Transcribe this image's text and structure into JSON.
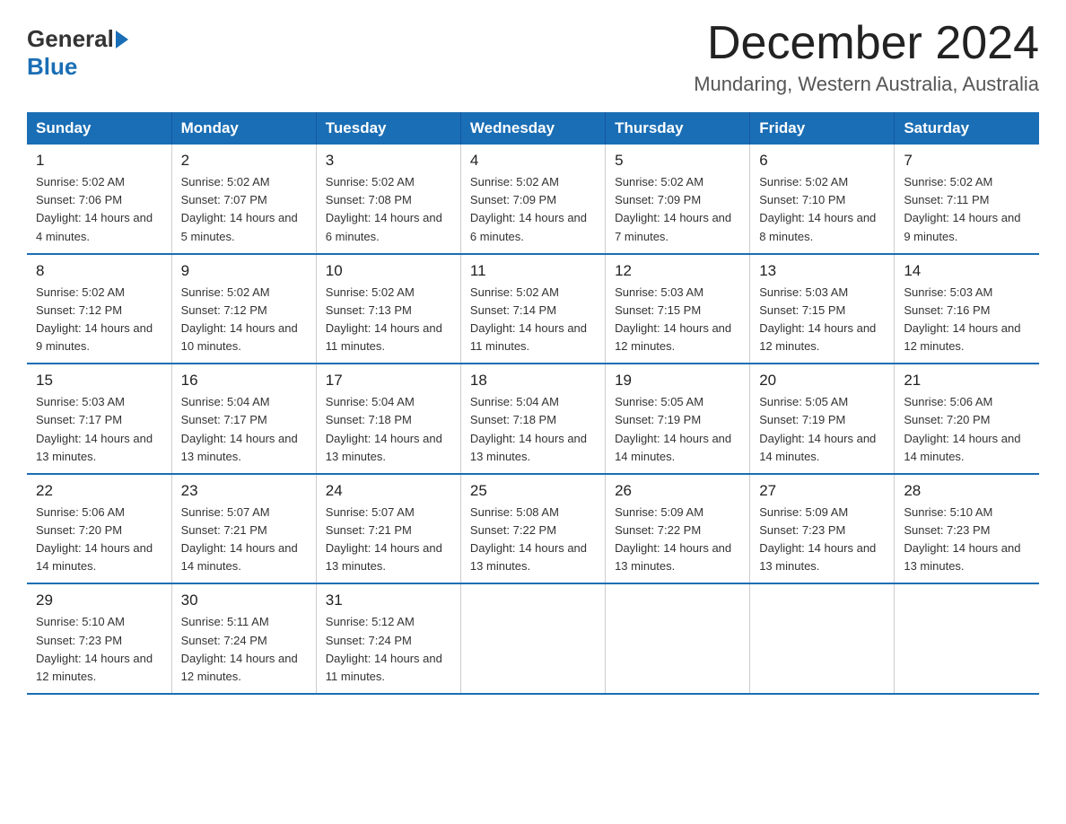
{
  "logo": {
    "general": "General",
    "blue": "Blue"
  },
  "title": "December 2024",
  "location": "Mundaring, Western Australia, Australia",
  "days_of_week": [
    "Sunday",
    "Monday",
    "Tuesday",
    "Wednesday",
    "Thursday",
    "Friday",
    "Saturday"
  ],
  "weeks": [
    [
      {
        "day": "1",
        "sunrise": "5:02 AM",
        "sunset": "7:06 PM",
        "daylight": "14 hours and 4 minutes."
      },
      {
        "day": "2",
        "sunrise": "5:02 AM",
        "sunset": "7:07 PM",
        "daylight": "14 hours and 5 minutes."
      },
      {
        "day": "3",
        "sunrise": "5:02 AM",
        "sunset": "7:08 PM",
        "daylight": "14 hours and 6 minutes."
      },
      {
        "day": "4",
        "sunrise": "5:02 AM",
        "sunset": "7:09 PM",
        "daylight": "14 hours and 6 minutes."
      },
      {
        "day": "5",
        "sunrise": "5:02 AM",
        "sunset": "7:09 PM",
        "daylight": "14 hours and 7 minutes."
      },
      {
        "day": "6",
        "sunrise": "5:02 AM",
        "sunset": "7:10 PM",
        "daylight": "14 hours and 8 minutes."
      },
      {
        "day": "7",
        "sunrise": "5:02 AM",
        "sunset": "7:11 PM",
        "daylight": "14 hours and 9 minutes."
      }
    ],
    [
      {
        "day": "8",
        "sunrise": "5:02 AM",
        "sunset": "7:12 PM",
        "daylight": "14 hours and 9 minutes."
      },
      {
        "day": "9",
        "sunrise": "5:02 AM",
        "sunset": "7:12 PM",
        "daylight": "14 hours and 10 minutes."
      },
      {
        "day": "10",
        "sunrise": "5:02 AM",
        "sunset": "7:13 PM",
        "daylight": "14 hours and 11 minutes."
      },
      {
        "day": "11",
        "sunrise": "5:02 AM",
        "sunset": "7:14 PM",
        "daylight": "14 hours and 11 minutes."
      },
      {
        "day": "12",
        "sunrise": "5:03 AM",
        "sunset": "7:15 PM",
        "daylight": "14 hours and 12 minutes."
      },
      {
        "day": "13",
        "sunrise": "5:03 AM",
        "sunset": "7:15 PM",
        "daylight": "14 hours and 12 minutes."
      },
      {
        "day": "14",
        "sunrise": "5:03 AM",
        "sunset": "7:16 PM",
        "daylight": "14 hours and 12 minutes."
      }
    ],
    [
      {
        "day": "15",
        "sunrise": "5:03 AM",
        "sunset": "7:17 PM",
        "daylight": "14 hours and 13 minutes."
      },
      {
        "day": "16",
        "sunrise": "5:04 AM",
        "sunset": "7:17 PM",
        "daylight": "14 hours and 13 minutes."
      },
      {
        "day": "17",
        "sunrise": "5:04 AM",
        "sunset": "7:18 PM",
        "daylight": "14 hours and 13 minutes."
      },
      {
        "day": "18",
        "sunrise": "5:04 AM",
        "sunset": "7:18 PM",
        "daylight": "14 hours and 13 minutes."
      },
      {
        "day": "19",
        "sunrise": "5:05 AM",
        "sunset": "7:19 PM",
        "daylight": "14 hours and 14 minutes."
      },
      {
        "day": "20",
        "sunrise": "5:05 AM",
        "sunset": "7:19 PM",
        "daylight": "14 hours and 14 minutes."
      },
      {
        "day": "21",
        "sunrise": "5:06 AM",
        "sunset": "7:20 PM",
        "daylight": "14 hours and 14 minutes."
      }
    ],
    [
      {
        "day": "22",
        "sunrise": "5:06 AM",
        "sunset": "7:20 PM",
        "daylight": "14 hours and 14 minutes."
      },
      {
        "day": "23",
        "sunrise": "5:07 AM",
        "sunset": "7:21 PM",
        "daylight": "14 hours and 14 minutes."
      },
      {
        "day": "24",
        "sunrise": "5:07 AM",
        "sunset": "7:21 PM",
        "daylight": "14 hours and 13 minutes."
      },
      {
        "day": "25",
        "sunrise": "5:08 AM",
        "sunset": "7:22 PM",
        "daylight": "14 hours and 13 minutes."
      },
      {
        "day": "26",
        "sunrise": "5:09 AM",
        "sunset": "7:22 PM",
        "daylight": "14 hours and 13 minutes."
      },
      {
        "day": "27",
        "sunrise": "5:09 AM",
        "sunset": "7:23 PM",
        "daylight": "14 hours and 13 minutes."
      },
      {
        "day": "28",
        "sunrise": "5:10 AM",
        "sunset": "7:23 PM",
        "daylight": "14 hours and 13 minutes."
      }
    ],
    [
      {
        "day": "29",
        "sunrise": "5:10 AM",
        "sunset": "7:23 PM",
        "daylight": "14 hours and 12 minutes."
      },
      {
        "day": "30",
        "sunrise": "5:11 AM",
        "sunset": "7:24 PM",
        "daylight": "14 hours and 12 minutes."
      },
      {
        "day": "31",
        "sunrise": "5:12 AM",
        "sunset": "7:24 PM",
        "daylight": "14 hours and 11 minutes."
      },
      null,
      null,
      null,
      null
    ]
  ]
}
